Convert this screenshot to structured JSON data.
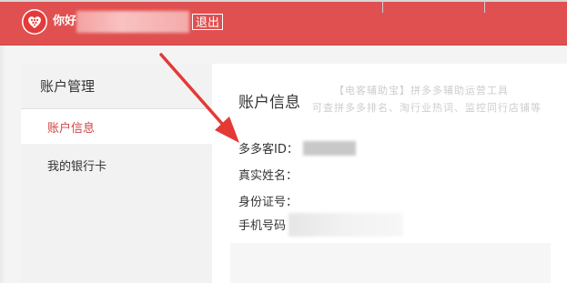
{
  "header": {
    "greeting": "你好",
    "logout_label": "退出",
    "brand_color": "#e05050"
  },
  "sidebar": {
    "title": "账户管理",
    "items": [
      {
        "label": "账户信息",
        "active": true
      },
      {
        "label": "我的银行卡",
        "active": false
      }
    ],
    "active_color": "#d24545"
  },
  "main": {
    "title": "账户信息",
    "watermark": {
      "line1": "【电客辅助宝】拼多多辅助运营工具",
      "line2": "可查拼多多排名、淘行业热词、监控同行店铺等"
    },
    "fields": [
      {
        "label": "多多客ID："
      },
      {
        "label": "真实姓名："
      },
      {
        "label": "身份证号："
      },
      {
        "label": "手机号码"
      }
    ]
  },
  "annotation": {
    "arrow_color": "#e53935",
    "icon": "arrow-icon"
  },
  "icons": {
    "logo": "pinduoduo-heart-logo-icon"
  }
}
